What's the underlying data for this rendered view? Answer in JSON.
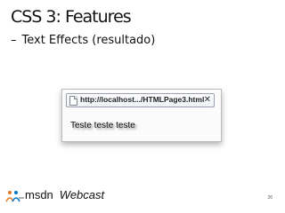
{
  "slide": {
    "title": "CSS 3: Features",
    "subtitle_dash": "–",
    "subtitle": "Text Effects (resultado)",
    "page_number": "26"
  },
  "browser": {
    "tab_url": "http://localhost.../HTMLPage3.html",
    "close_glyph": "✕",
    "content_text": "Teste teste teste",
    "icons": [
      "page-icon",
      "close-icon"
    ]
  },
  "footer": {
    "brand": "msdn",
    "product": "Webcast",
    "logo_icon": "people-logo-icon"
  },
  "colors": {
    "title": "#111111",
    "text_shadow": "rgba(0,0,0,0.45)",
    "logo_orange": "#e87722",
    "logo_blue": "#0078c8"
  }
}
